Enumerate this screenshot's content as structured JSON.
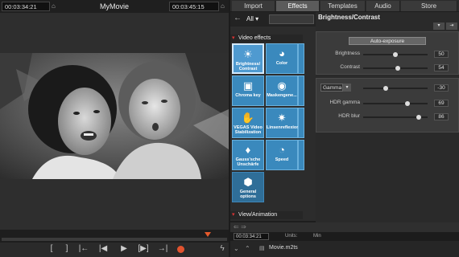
{
  "preview": {
    "timecode_left": "00:03:34:21",
    "title": "MyMovie",
    "timecode_right": "00:03:45:15"
  },
  "transport": {
    "buttons": [
      "[",
      "]",
      "|←",
      "|◀",
      "▶",
      "[▶]",
      "→|"
    ]
  },
  "tabs": [
    {
      "label": "Import",
      "active": false
    },
    {
      "label": "Effects",
      "active": true
    },
    {
      "label": "Templates",
      "active": false
    },
    {
      "label": "Audio",
      "active": false
    },
    {
      "label": "Store",
      "active": false
    }
  ],
  "effects_panel": {
    "filter": "All",
    "categories": [
      "Video effects",
      "View/Animation"
    ],
    "tiles": [
      {
        "label": "Brightness/ Contrast",
        "icon": "sun-icon",
        "glyph": "☀"
      },
      {
        "label": "Color",
        "icon": "palette-icon",
        "glyph": "🎨"
      },
      {
        "label": "Chroma key",
        "icon": "chroma-key-icon",
        "glyph": "▣"
      },
      {
        "label": "Maskengene...",
        "icon": "mask-icon",
        "glyph": "◉"
      },
      {
        "label": "VEGAS Video Stabilization",
        "icon": "stabilization-icon",
        "glyph": "✋"
      },
      {
        "label": "Linsenreflexion",
        "icon": "lens-flare-icon",
        "glyph": "✷"
      },
      {
        "label": "Gauss'sche Unschärfe",
        "icon": "blur-drop-icon",
        "glyph": "💧"
      },
      {
        "label": "Speed",
        "icon": "speedometer-icon",
        "glyph": "◔"
      },
      {
        "label": "General options",
        "icon": "hexagon-icon",
        "glyph": "⬢"
      }
    ]
  },
  "properties": {
    "title": "Brightness/Contrast",
    "auto_exposure": "Auto-exposure",
    "brightness_label": "Brightness",
    "brightness_value": "50",
    "brightness_fraction": 0.5,
    "contrast_label": "Contrast",
    "contrast_value": "54",
    "contrast_fraction": 0.54,
    "gamma_mode": "Gamma",
    "gamma_value": "-30",
    "gamma_fraction": 0.35,
    "hdr_gamma_label": "HDR gamma",
    "hdr_gamma_value": "69",
    "hdr_gamma_fraction": 0.69,
    "hdr_blur_label": "HDR blur",
    "hdr_blur_value": "86",
    "hdr_blur_fraction": 0.86
  },
  "bottom": {
    "timecode": "00:03:34:21",
    "units_label": "Units:",
    "units_value": "Min",
    "file_name": "Movie.m2ts"
  }
}
